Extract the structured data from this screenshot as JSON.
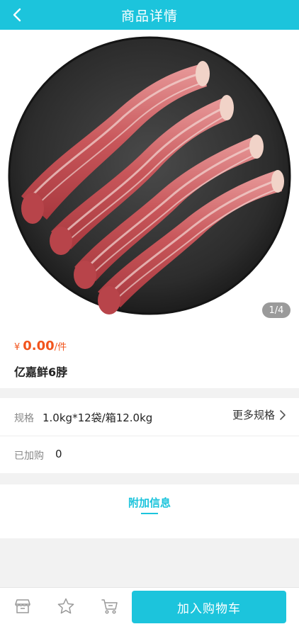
{
  "header": {
    "title": "商品详情"
  },
  "gallery": {
    "indicator": "1/4"
  },
  "product": {
    "currency": "¥",
    "price": "0.00",
    "unit": "/件",
    "name": "亿嘉鲜6脖"
  },
  "spec": {
    "label": "规格",
    "value": "1.0kg*12袋/箱12.0kg",
    "more_label": "更多规格"
  },
  "added": {
    "label": "已加购",
    "value": "0"
  },
  "extra_info": {
    "tab_label": "附加信息"
  },
  "bottom_bar": {
    "icons": [
      "store-icon",
      "star-icon",
      "cart-icon"
    ],
    "add_to_cart_label": "加入购物车"
  },
  "colors": {
    "accent": "#1cc4dc",
    "price": "#f2541c"
  }
}
